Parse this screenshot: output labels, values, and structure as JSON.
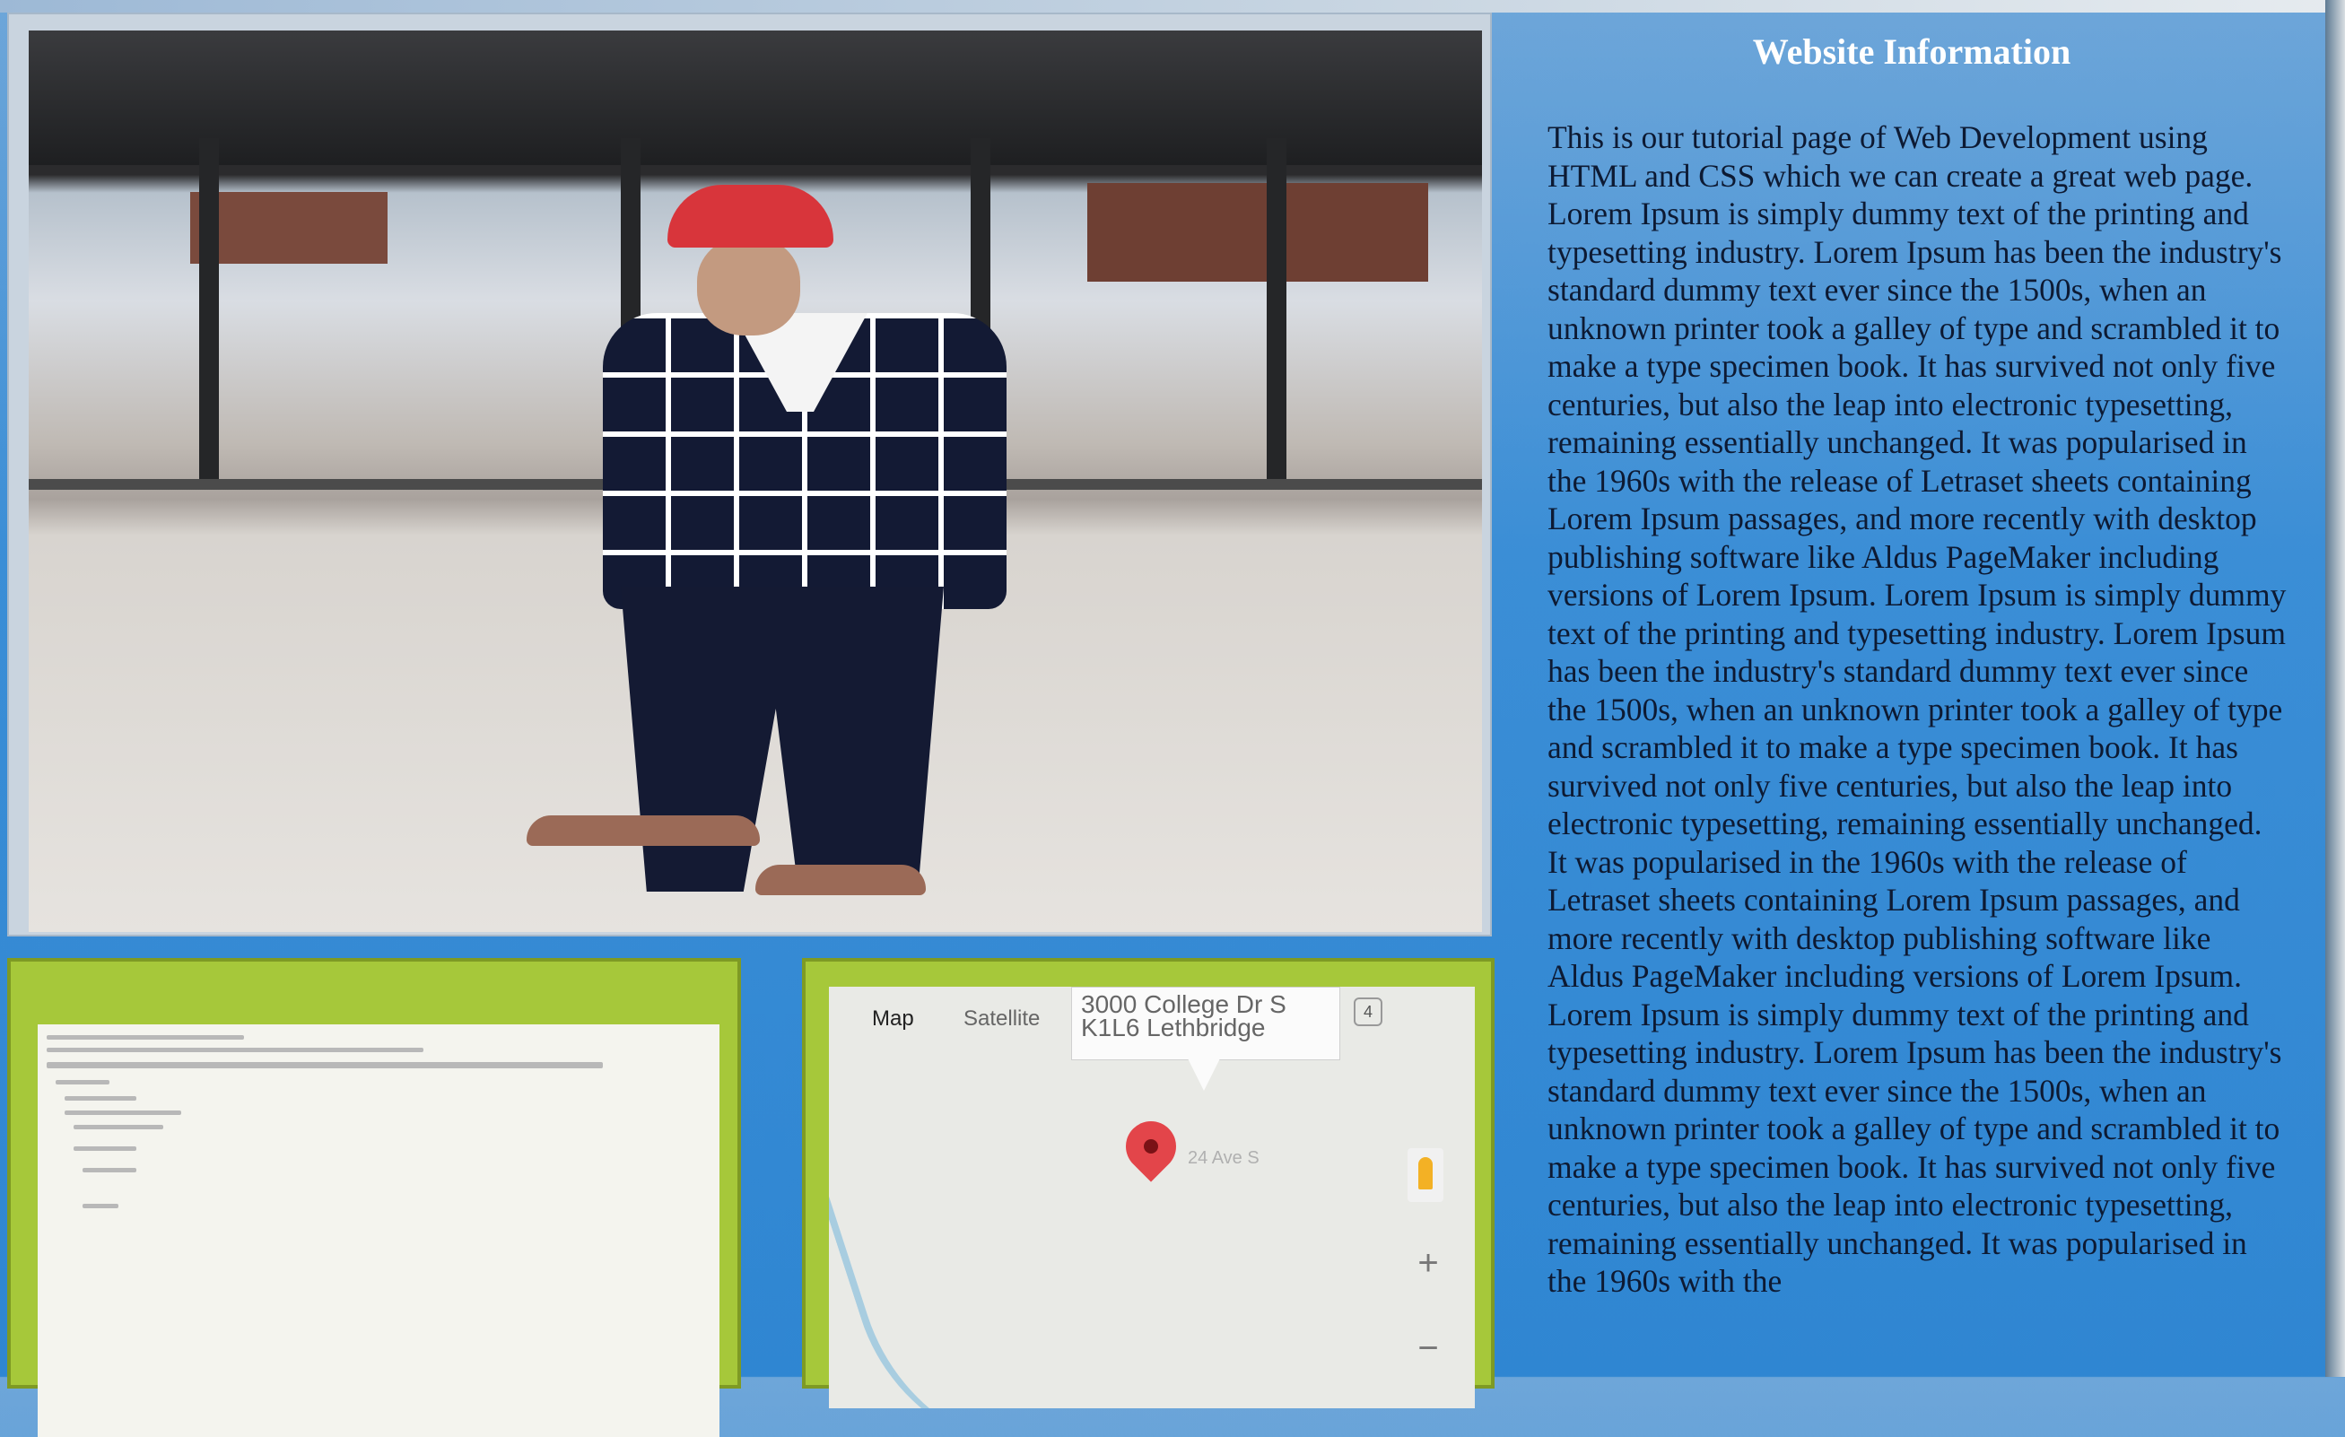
{
  "sidebar": {
    "title": "Website Information",
    "body": "This is our tutorial page of Web Development using HTML and CSS which we can create a great web page. Lorem Ipsum is simply dummy text of the printing and typesetting industry. Lorem Ipsum has been the industry's standard dummy text ever since the 1500s, when an unknown printer took a galley of type and scrambled it to make a type specimen book. It has survived not only five centuries, but also the leap into electronic typesetting, remaining essentially unchanged. It was popularised in the 1960s with the release of Letraset sheets containing Lorem Ipsum passages, and more recently with desktop publishing software like Aldus PageMaker including versions of Lorem Ipsum. Lorem Ipsum is simply dummy text of the printing and typesetting industry. Lorem Ipsum has been the industry's standard dummy text ever since the 1500s, when an unknown printer took a galley of type and scrambled it to make a type specimen book. It has survived not only five centuries, but also the leap into electronic typesetting, remaining essentially unchanged. It was popularised in the 1960s with the release of Letraset sheets containing Lorem Ipsum passages, and more recently with desktop publishing software like Aldus PageMaker including versions of Lorem Ipsum. Lorem Ipsum is simply dummy text of the printing and typesetting industry. Lorem Ipsum has been the industry's standard dummy text ever since the 1500s, when an unknown printer took a galley of type and scrambled it to make a type specimen book. It has survived not only five centuries, but also the leap into electronic typesetting, remaining essentially unchanged. It was popularised in the 1960s with the"
  },
  "map": {
    "map_tab": "Map",
    "satellite_tab": "Satellite",
    "address_line1": "3000 College Dr S",
    "address_line2": "K1L6 Lethbridge",
    "badge": "4",
    "road_label": "24 Ave S",
    "zoom_in": "+",
    "zoom_out": "−"
  },
  "colors": {
    "page_background": "#3b8ed6",
    "panel_green": "#a6c83a",
    "title_text": "#ffffff",
    "body_text": "#0d1a33",
    "map_pin": "#e3454a"
  },
  "icons": {
    "map_pin": "map-pin-icon",
    "pegman": "pegman-icon",
    "close": "close-icon"
  }
}
